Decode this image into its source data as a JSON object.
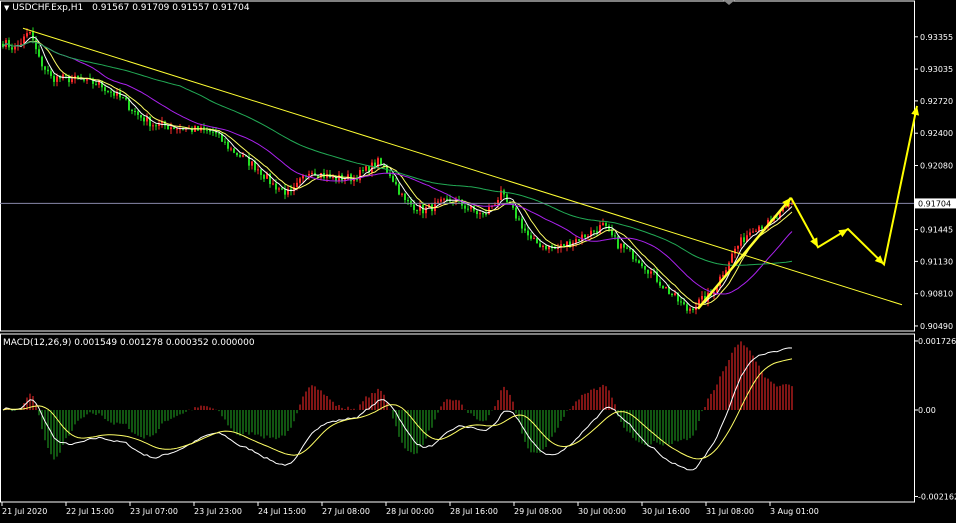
{
  "header": {
    "dropdown_glyph": "▼",
    "symbol": "USDCHF.Exp,H1",
    "ohlc": "0.91567 0.91709 0.91557 0.91704"
  },
  "macd_header": "MACD(12,26,9) 0.001549 0.001278 0.000352 0.000000",
  "colors": {
    "background": "#000000",
    "frame": "#ffffff",
    "bull_candle": "#ff2a2a",
    "bear_candle": "#22dd22",
    "ma_fast": "#ffffff",
    "ma_mid": "#ffff66",
    "ma_slow": "#22aa55",
    "ma_purple": "#aa22ee",
    "trendline": "#ffff33",
    "forecast": "#ffff00",
    "bid_line": "#8888aa",
    "hist_pos": "#ff2a2a",
    "hist_neg": "#22aa22",
    "macd_main": "#ffffff",
    "macd_signal": "#ffff66"
  },
  "chart_data": [
    {
      "type": "candlestick",
      "symbol": "USDCHF.Exp",
      "timeframe": "H1",
      "y_ticks": [
        "0.93355",
        "0.93035",
        "0.92720",
        "0.92400",
        "0.92080",
        "0.91445",
        "0.91130",
        "0.90810",
        "0.90490"
      ],
      "ylim": [
        0.9044,
        0.9369
      ],
      "current_price_label": "0.91704",
      "current_price": 0.91704,
      "x_labels": [
        "21 Jul 2020",
        "22 Jul 15:00",
        "23 Jul 07:00",
        "23 Jul 23:00",
        "24 Jul 15:00",
        "27 Jul 08:00",
        "28 Jul 00:00",
        "28 Jul 16:00",
        "29 Jul 08:00",
        "30 Jul 00:00",
        "30 Jul 16:00",
        "31 Jul 08:00",
        "3 Aug 01:00"
      ],
      "close_anchors": [
        [
          0,
          0.933
        ],
        [
          4,
          0.9324
        ],
        [
          9,
          0.934
        ],
        [
          12,
          0.9313
        ],
        [
          16,
          0.9295
        ],
        [
          22,
          0.9294
        ],
        [
          32,
          0.9289
        ],
        [
          40,
          0.9273
        ],
        [
          45,
          0.9258
        ],
        [
          50,
          0.9249
        ],
        [
          60,
          0.9245
        ],
        [
          70,
          0.9241
        ],
        [
          76,
          0.9224
        ],
        [
          85,
          0.9205
        ],
        [
          90,
          0.9189
        ],
        [
          96,
          0.9179
        ],
        [
          102,
          0.9204
        ],
        [
          110,
          0.9195
        ],
        [
          117,
          0.9196
        ],
        [
          125,
          0.9211
        ],
        [
          129,
          0.92
        ],
        [
          134,
          0.9172
        ],
        [
          140,
          0.9164
        ],
        [
          150,
          0.9174
        ],
        [
          160,
          0.9158
        ],
        [
          166,
          0.9179
        ],
        [
          172,
          0.9154
        ],
        [
          176,
          0.9133
        ],
        [
          184,
          0.9125
        ],
        [
          192,
          0.9136
        ],
        [
          200,
          0.9148
        ],
        [
          205,
          0.913
        ],
        [
          212,
          0.9115
        ],
        [
          220,
          0.9089
        ],
        [
          228,
          0.9065
        ],
        [
          236,
          0.908
        ],
        [
          244,
          0.9125
        ],
        [
          250,
          0.9147
        ],
        [
          256,
          0.9151
        ],
        [
          262,
          0.9168
        ],
        [
          263,
          0.91704
        ]
      ],
      "trendlines": [
        {
          "name": "upper-resistance",
          "from": [
            7,
            0.9344
          ],
          "to": [
            300,
            0.907
          ]
        },
        {
          "name": "breakout-arrow",
          "from": [
            232,
            0.9066
          ],
          "to": [
            263,
            0.9176
          ]
        }
      ],
      "forecast_path": [
        [
          263,
          0.9176
        ],
        [
          272,
          0.9127
        ],
        [
          282,
          0.9145
        ],
        [
          294,
          0.911
        ],
        [
          305,
          0.9267
        ]
      ],
      "moving_averages": [
        "fast white",
        "yellow",
        "purple",
        "green"
      ]
    },
    {
      "type": "macd",
      "title": "MACD(12,26,9) 0.001549 0.001278 0.000352 0.000000",
      "params": [
        12,
        26,
        9
      ],
      "values": {
        "main": 0.001549,
        "signal": 0.001278,
        "histogram": 0.000352,
        "extra": 0.0
      },
      "y_ticks": [
        "0.001726",
        "0.00",
        "-0.002162"
      ],
      "ylim": [
        -0.0023,
        0.0019
      ]
    }
  ]
}
